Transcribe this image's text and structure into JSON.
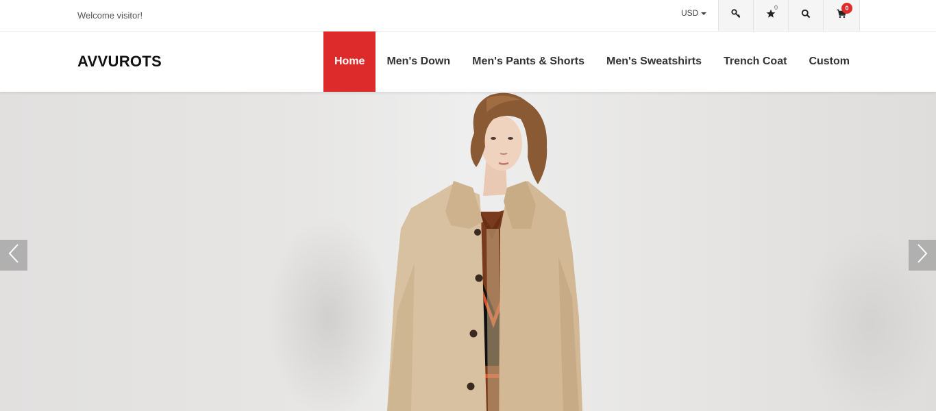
{
  "topbar": {
    "welcome": "Welcome visitor!",
    "currency": "USD",
    "icons": [
      "key-icon",
      "star-icon",
      "search-icon",
      "cart-icon"
    ],
    "wishlist_count": "0",
    "cart_count": "0"
  },
  "header": {
    "logo": "AVVUROTS",
    "nav": [
      {
        "label": "Home",
        "active": true
      },
      {
        "label": "Men's Down"
      },
      {
        "label": "Men's Pants & Shorts"
      },
      {
        "label": "Men's Sweatshirts"
      },
      {
        "label": "Trench Coat"
      },
      {
        "label": "Custom"
      }
    ]
  },
  "hero": {
    "prev_icon": "chevron-left-icon",
    "next_icon": "chevron-right-icon"
  },
  "colors": {
    "accent": "#dd2a2a",
    "badge": "#e02b2b"
  }
}
